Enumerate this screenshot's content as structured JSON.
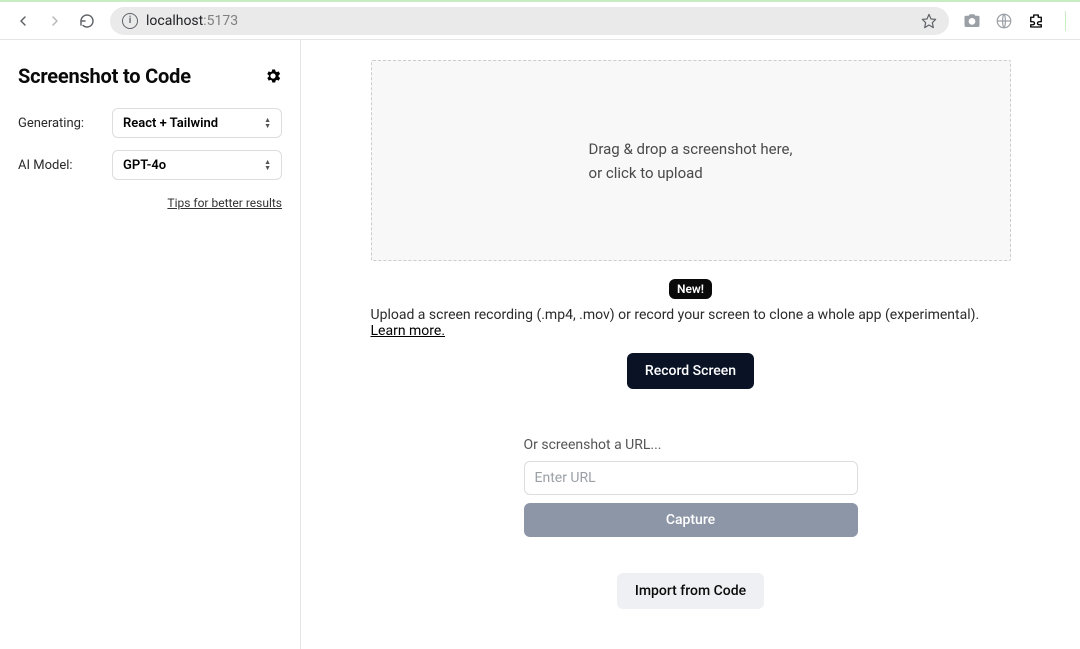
{
  "browser": {
    "url_host": "localhost",
    "url_port": ":5173"
  },
  "sidebar": {
    "title": "Screenshot to Code",
    "generating_label": "Generating:",
    "generating_value": "React + Tailwind",
    "model_label": "AI Model:",
    "model_value": "GPT-4o",
    "tips_link": "Tips for better results"
  },
  "main": {
    "dropzone_line1": "Drag & drop a screenshot here,",
    "dropzone_line2": "or click to upload",
    "new_badge": "New!",
    "recording_text": "Upload a screen recording (.mp4, .mov) or record your screen to clone a whole app (experimental).",
    "learn_more": "Learn more.",
    "record_button": "Record Screen",
    "url_label": "Or screenshot a URL...",
    "url_placeholder": "Enter URL",
    "capture_button": "Capture",
    "import_button": "Import from Code"
  }
}
